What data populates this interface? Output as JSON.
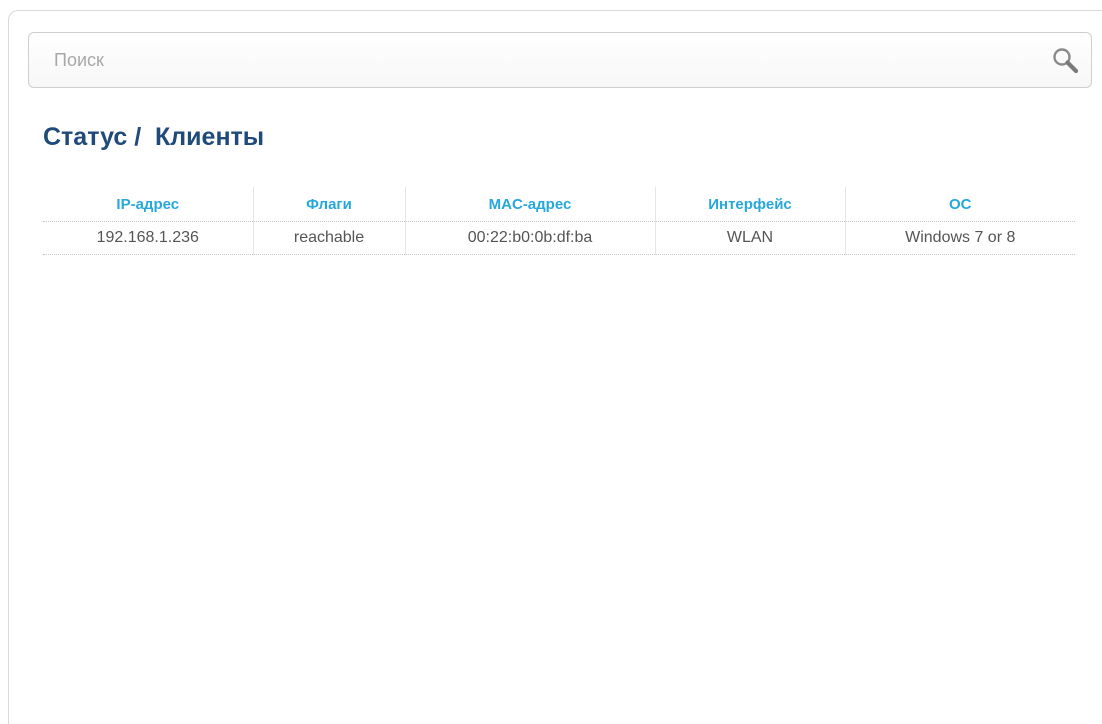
{
  "search": {
    "placeholder": "Поиск",
    "value": ""
  },
  "page": {
    "title": "Статус /  Клиенты"
  },
  "table": {
    "headers": [
      "IP-адрес",
      "Флаги",
      "MAC-адрес",
      "Интерфейс",
      "ОС"
    ],
    "rows": [
      [
        "192.168.1.236",
        "reachable",
        "00:22:b0:0b:df:ba",
        "WLAN",
        "Windows 7 or 8"
      ]
    ]
  },
  "colors": {
    "title": "#1f4a7a",
    "header": "#27a8dc",
    "cell_text": "#555555"
  },
  "icons": {
    "search": "search-icon"
  }
}
